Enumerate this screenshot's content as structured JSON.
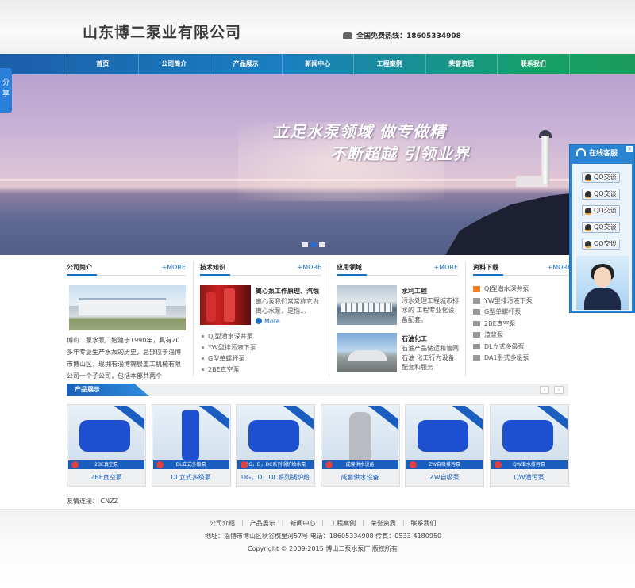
{
  "header": {
    "company_name": "山东博二泵业有限公司",
    "hotline": "全国免费热线：18605334908"
  },
  "share_tab": {
    "label": "分享"
  },
  "nav": {
    "items": [
      "首页",
      "公司简介",
      "产品展示",
      "新闻中心",
      "工程案例",
      "荣誉资质",
      "联系我们"
    ]
  },
  "banner": {
    "slogan_line1": "立足水泵领域 做专做精",
    "slogan_line2": "不断超越 引领业界",
    "slide_count": 3,
    "active_slide": 2
  },
  "online_service": {
    "title": "在线客服",
    "close": "×",
    "buttons": [
      "QQ交谈",
      "QQ交谈",
      "QQ交谈",
      "QQ交谈",
      "QQ交谈"
    ]
  },
  "more_label": "+MORE",
  "about": {
    "title": "公司简介",
    "text": "博山二泵水泵厂始建于1990年，具有20多年专业生产水泵的历史，总部位于淄博市博山区，现拥有淄博锦晨重工机械有限公司一个子公司，包括本部共两个"
  },
  "tech": {
    "title": "技术知识",
    "article_title": "离心泵工作原理、汽蚀",
    "article_desc": "离心泵我们常常称它为离心水泵，是指...",
    "more": "More",
    "list": [
      "QJ型潜水深井泵",
      "YW型排污液下泵",
      "G型单螺杆泵",
      "2BE真空泵"
    ]
  },
  "apps": {
    "title": "应用领域",
    "items": [
      {
        "title": "水利工程",
        "desc": "污水处理工程城市排水的 工程专业化设备配套。"
      },
      {
        "title": "石油化工",
        "desc": "石油产品储运和管网石油 化工行为设备配套和服务"
      }
    ]
  },
  "downloads": {
    "title": "资料下载",
    "items": [
      "QJ型潜水深井泵",
      "YW型排污液下泵",
      "G型单螺杆泵",
      "2BE真空泵",
      "渣浆泵",
      "DL立式多级泵",
      "DA1卧式多级泵"
    ]
  },
  "products": {
    "title": "产品展示",
    "prev": "‹",
    "next": "›",
    "items": [
      {
        "caption": "2BE真空泵",
        "name": "2BE真空泵"
      },
      {
        "caption": "DL立式多级泵",
        "name": "DL立式多级泵"
      },
      {
        "caption": "DG，D，DC系列锅炉给水泵",
        "name": "DG，D，DC系列锅炉给"
      },
      {
        "caption": "成套供水设备",
        "name": "成套供水设备"
      },
      {
        "caption": "ZW自吸排污泵",
        "name": "ZW自吸泵"
      },
      {
        "caption": "QW潜水排污泵",
        "name": "QW潜污泵"
      }
    ]
  },
  "friend_links": {
    "label": "友情连接：",
    "items": [
      "CNZZ"
    ]
  },
  "footer": {
    "nav": [
      "公司介绍",
      "产品展示",
      "新闻中心",
      "工程案例",
      "荣誉资质",
      "联系我们"
    ],
    "address": "地址：淄博市博山区秋谷槐里河57号  电话：18605334908  传真：0533-4180950",
    "copyright": "Copyright © 2009-2015 博山二泵水泵厂 版权所有"
  },
  "colors": {
    "brand_blue": "#1a6fc2",
    "nav_green": "#17a067"
  }
}
